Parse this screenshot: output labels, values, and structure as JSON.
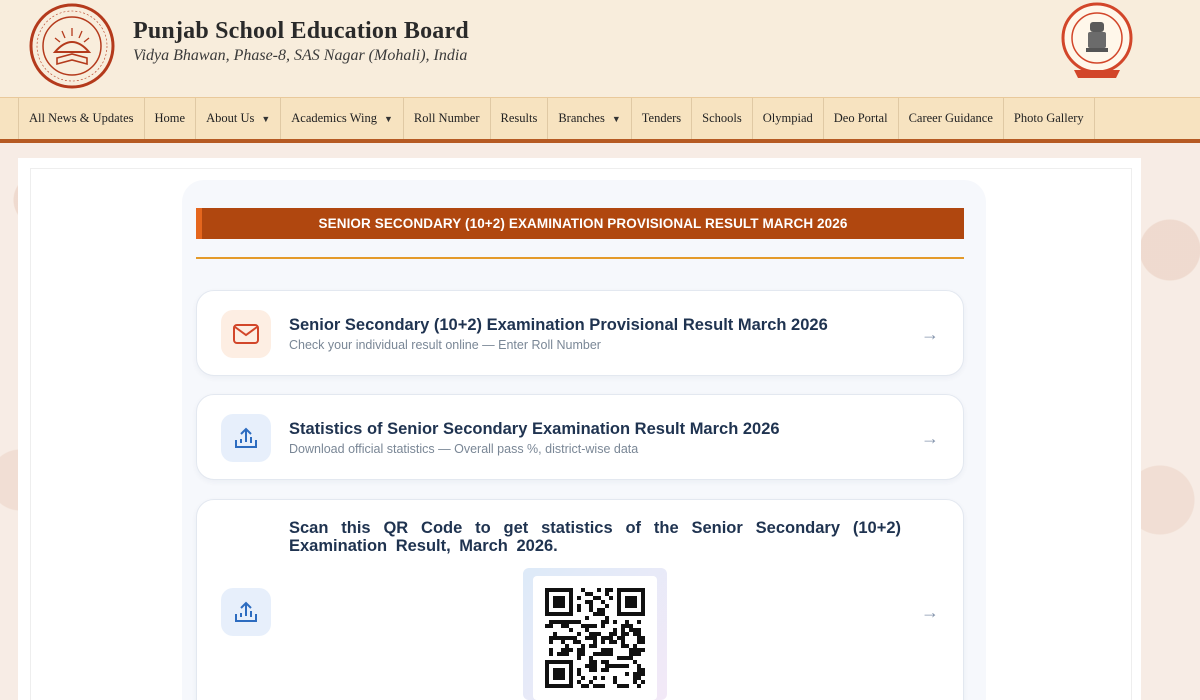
{
  "header": {
    "title": "Punjab School Education Board",
    "subtitle": "Vidya Bhawan, Phase-8, SAS Nagar (Mohali), India",
    "left_logo_icon": "pseb-emblem-icon",
    "right_logo_icon": "punjab-govt-seal-icon"
  },
  "nav": {
    "items": [
      {
        "label": "All News & Updates",
        "dropdown": false
      },
      {
        "label": "Home",
        "dropdown": false
      },
      {
        "label": "About Us",
        "dropdown": true
      },
      {
        "label": "Academics Wing",
        "dropdown": true
      },
      {
        "label": "Roll Number",
        "dropdown": false
      },
      {
        "label": "Results",
        "dropdown": false
      },
      {
        "label": "Branches",
        "dropdown": true
      },
      {
        "label": "Tenders",
        "dropdown": false
      },
      {
        "label": "Schools",
        "dropdown": false
      },
      {
        "label": "Olympiad",
        "dropdown": false
      },
      {
        "label": "Deo Portal",
        "dropdown": false
      },
      {
        "label": "Career Guidance",
        "dropdown": false
      },
      {
        "label": "Photo Gallery",
        "dropdown": false
      }
    ],
    "caret": "▼"
  },
  "banner": {
    "title": "SENIOR SECONDARY (10+2) EXAMINATION PROVISIONAL RESULT MARCH 2026"
  },
  "cards": [
    {
      "icon": "mail-icon",
      "title": "Senior Secondary (10+2) Examination Provisional Result March 2026",
      "subtitle": "Check your individual result online — Enter Roll Number",
      "arrow": "→"
    },
    {
      "icon": "upload-chart-icon",
      "title": "Statistics of Senior Secondary Examination Result March 2026",
      "subtitle": "Download official statistics — Overall pass %, district-wise data",
      "arrow": "→"
    },
    {
      "icon": "upload-chart-icon",
      "title": "Scan this QR Code to get statistics of the Senior Secondary (10+2) Examination Result, March 2026.",
      "arrow": "→",
      "qr_icon": "qr-code-icon"
    }
  ],
  "colors": {
    "header_bg": "#f8eddc",
    "nav_bg": "#f7e3c0",
    "nav_border": "#b65a23",
    "banner_bg": "#b0470f",
    "banner_accent": "#e5661d",
    "rule": "#e49a2a",
    "title_text": "#1f3350"
  }
}
